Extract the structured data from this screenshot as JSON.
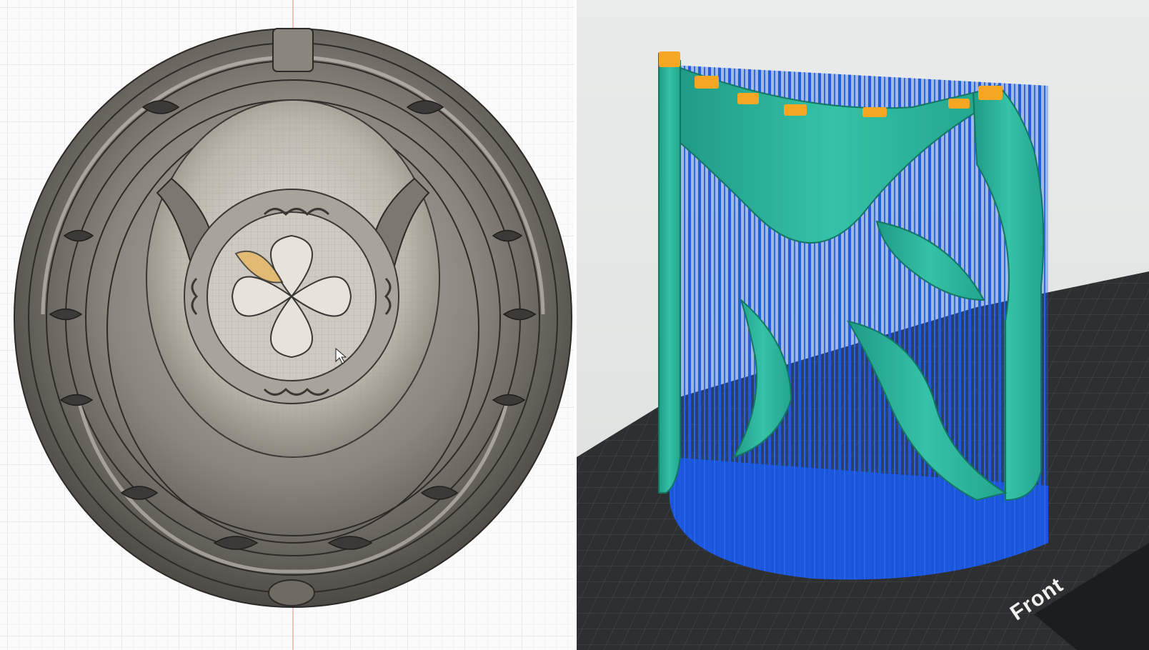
{
  "left_viewport": {
    "view": "cad-design-viewport",
    "object": "openwork-sphere-ornament",
    "background_color": "#fbfbfb",
    "grid_color": "#d9d9d9",
    "model_color": "#6b6761",
    "origin_axis_color": "#e05a4f"
  },
  "right_viewport": {
    "view": "slicer-preview",
    "model_color": "#2bb39a",
    "support_color": "#1f5fe0",
    "contact_tip_color": "#f5a623",
    "build_plate_color": "#2e2f31",
    "build_plate_label": "Front"
  }
}
